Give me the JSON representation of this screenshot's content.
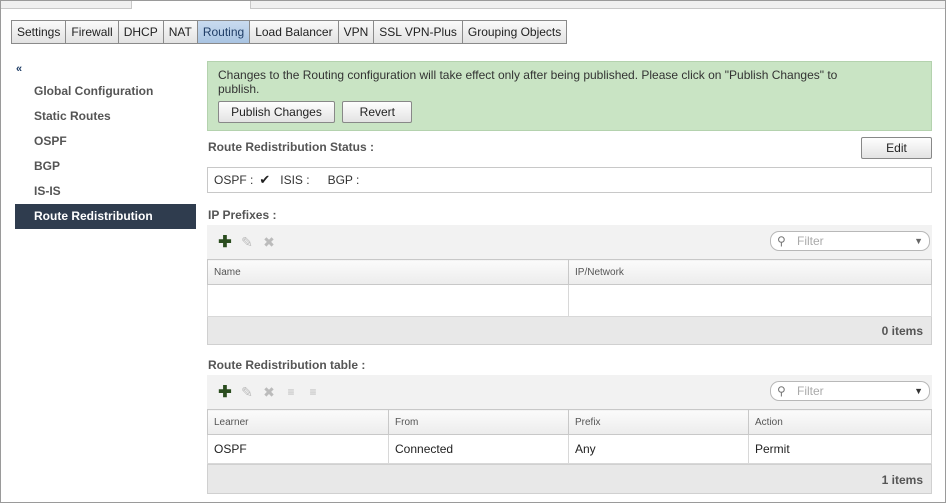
{
  "tabs": [
    "Settings",
    "Firewall",
    "DHCP",
    "NAT",
    "Routing",
    "Load Balancer",
    "VPN",
    "SSL VPN-Plus",
    "Grouping Objects"
  ],
  "active_tab": "Routing",
  "sidebar": {
    "collapse_label": "«",
    "items": [
      "Global Configuration",
      "Static Routes",
      "OSPF",
      "BGP",
      "IS-IS",
      "Route Redistribution"
    ],
    "active_item": "Route Redistribution"
  },
  "notice": {
    "text": "Changes to the Routing configuration will take effect only after being published. Please click on \"Publish Changes\" to publish.",
    "publish_label": "Publish Changes",
    "revert_label": "Revert"
  },
  "status": {
    "title": "Route Redistribution Status :",
    "edit_label": "Edit",
    "ospf_label": "OSPF :",
    "isis_label": "ISIS :",
    "bgp_label": "BGP :"
  },
  "ip_prefixes": {
    "title": "IP Prefixes :",
    "filter_placeholder": "Filter",
    "columns": [
      "Name",
      "IP/Network"
    ],
    "count_text": "0 items"
  },
  "redistribution_table": {
    "title": "Route Redistribution table :",
    "filter_placeholder": "Filter",
    "columns": [
      "Learner",
      "From",
      "Prefix",
      "Action"
    ],
    "rows": [
      [
        "OSPF",
        "Connected",
        "Any",
        "Permit"
      ]
    ],
    "count_text": "1 items"
  }
}
